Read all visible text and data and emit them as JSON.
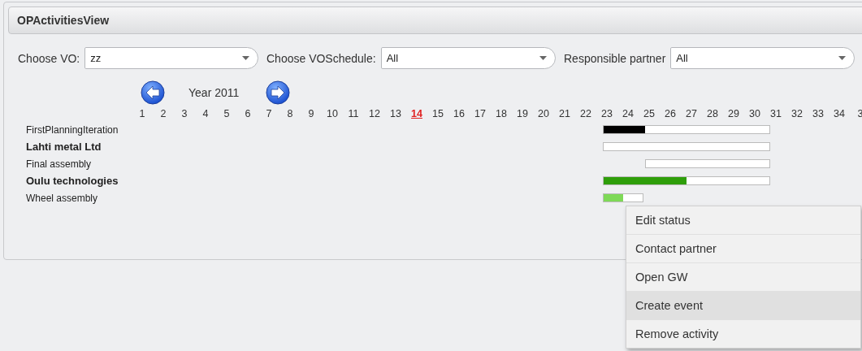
{
  "panel": {
    "title": "OPActivitiesView"
  },
  "filters": [
    {
      "label": "Choose VO:",
      "value": "zz"
    },
    {
      "label": "Choose VOSchedule:",
      "value": "All"
    },
    {
      "label": "Responsible partner",
      "value": "All"
    }
  ],
  "year_nav": {
    "label": "Year 2011"
  },
  "weeks": [
    {
      "label": "1",
      "current": false
    },
    {
      "label": "2",
      "current": false
    },
    {
      "label": "3",
      "current": false
    },
    {
      "label": "4",
      "current": false
    },
    {
      "label": "5",
      "current": false
    },
    {
      "label": "6",
      "current": false
    },
    {
      "label": "7",
      "current": false
    },
    {
      "label": "8",
      "current": false
    },
    {
      "label": "9",
      "current": false
    },
    {
      "label": "10",
      "current": false
    },
    {
      "label": "11",
      "current": false
    },
    {
      "label": "12",
      "current": false
    },
    {
      "label": "13",
      "current": false
    },
    {
      "label": "14",
      "current": true
    },
    {
      "label": "15",
      "current": false
    },
    {
      "label": "16",
      "current": false
    },
    {
      "label": "17",
      "current": false
    },
    {
      "label": "18",
      "current": false
    },
    {
      "label": "19",
      "current": false
    },
    {
      "label": "20",
      "current": false
    },
    {
      "label": "21",
      "current": false
    },
    {
      "label": "22",
      "current": false
    },
    {
      "label": "23",
      "current": false
    },
    {
      "label": "24",
      "current": false
    },
    {
      "label": "25",
      "current": false
    },
    {
      "label": "26",
      "current": false
    },
    {
      "label": "27",
      "current": false
    },
    {
      "label": "28",
      "current": false
    },
    {
      "label": "29",
      "current": false
    },
    {
      "label": "30",
      "current": false
    },
    {
      "label": "31",
      "current": false
    },
    {
      "label": "32",
      "current": false
    },
    {
      "label": "33",
      "current": false
    },
    {
      "label": "34",
      "current": false
    },
    {
      "label": "3",
      "current": false
    }
  ],
  "rows": [
    {
      "kind": "schedule",
      "name": "FirstPlanningIteration",
      "level": 0.25,
      "color": "#000000"
    },
    {
      "kind": "partner",
      "name": "Lahti metal Ltd"
    },
    {
      "kind": "activity",
      "name": "Final assembly"
    },
    {
      "kind": "partner",
      "name": "Oulu technologies",
      "level": 0.5,
      "color": "#2e9e0a"
    },
    {
      "kind": "activity",
      "name": "Wheel assembly",
      "level": 0.5,
      "color": "#7ed957"
    }
  ],
  "context_menu": [
    {
      "label": "Edit status",
      "selected": false
    },
    {
      "label": "Contact partner",
      "selected": false
    },
    {
      "label": "Open GW",
      "selected": false
    },
    {
      "label": "Create event",
      "selected": true
    },
    {
      "label": "Remove activity",
      "selected": false
    }
  ]
}
